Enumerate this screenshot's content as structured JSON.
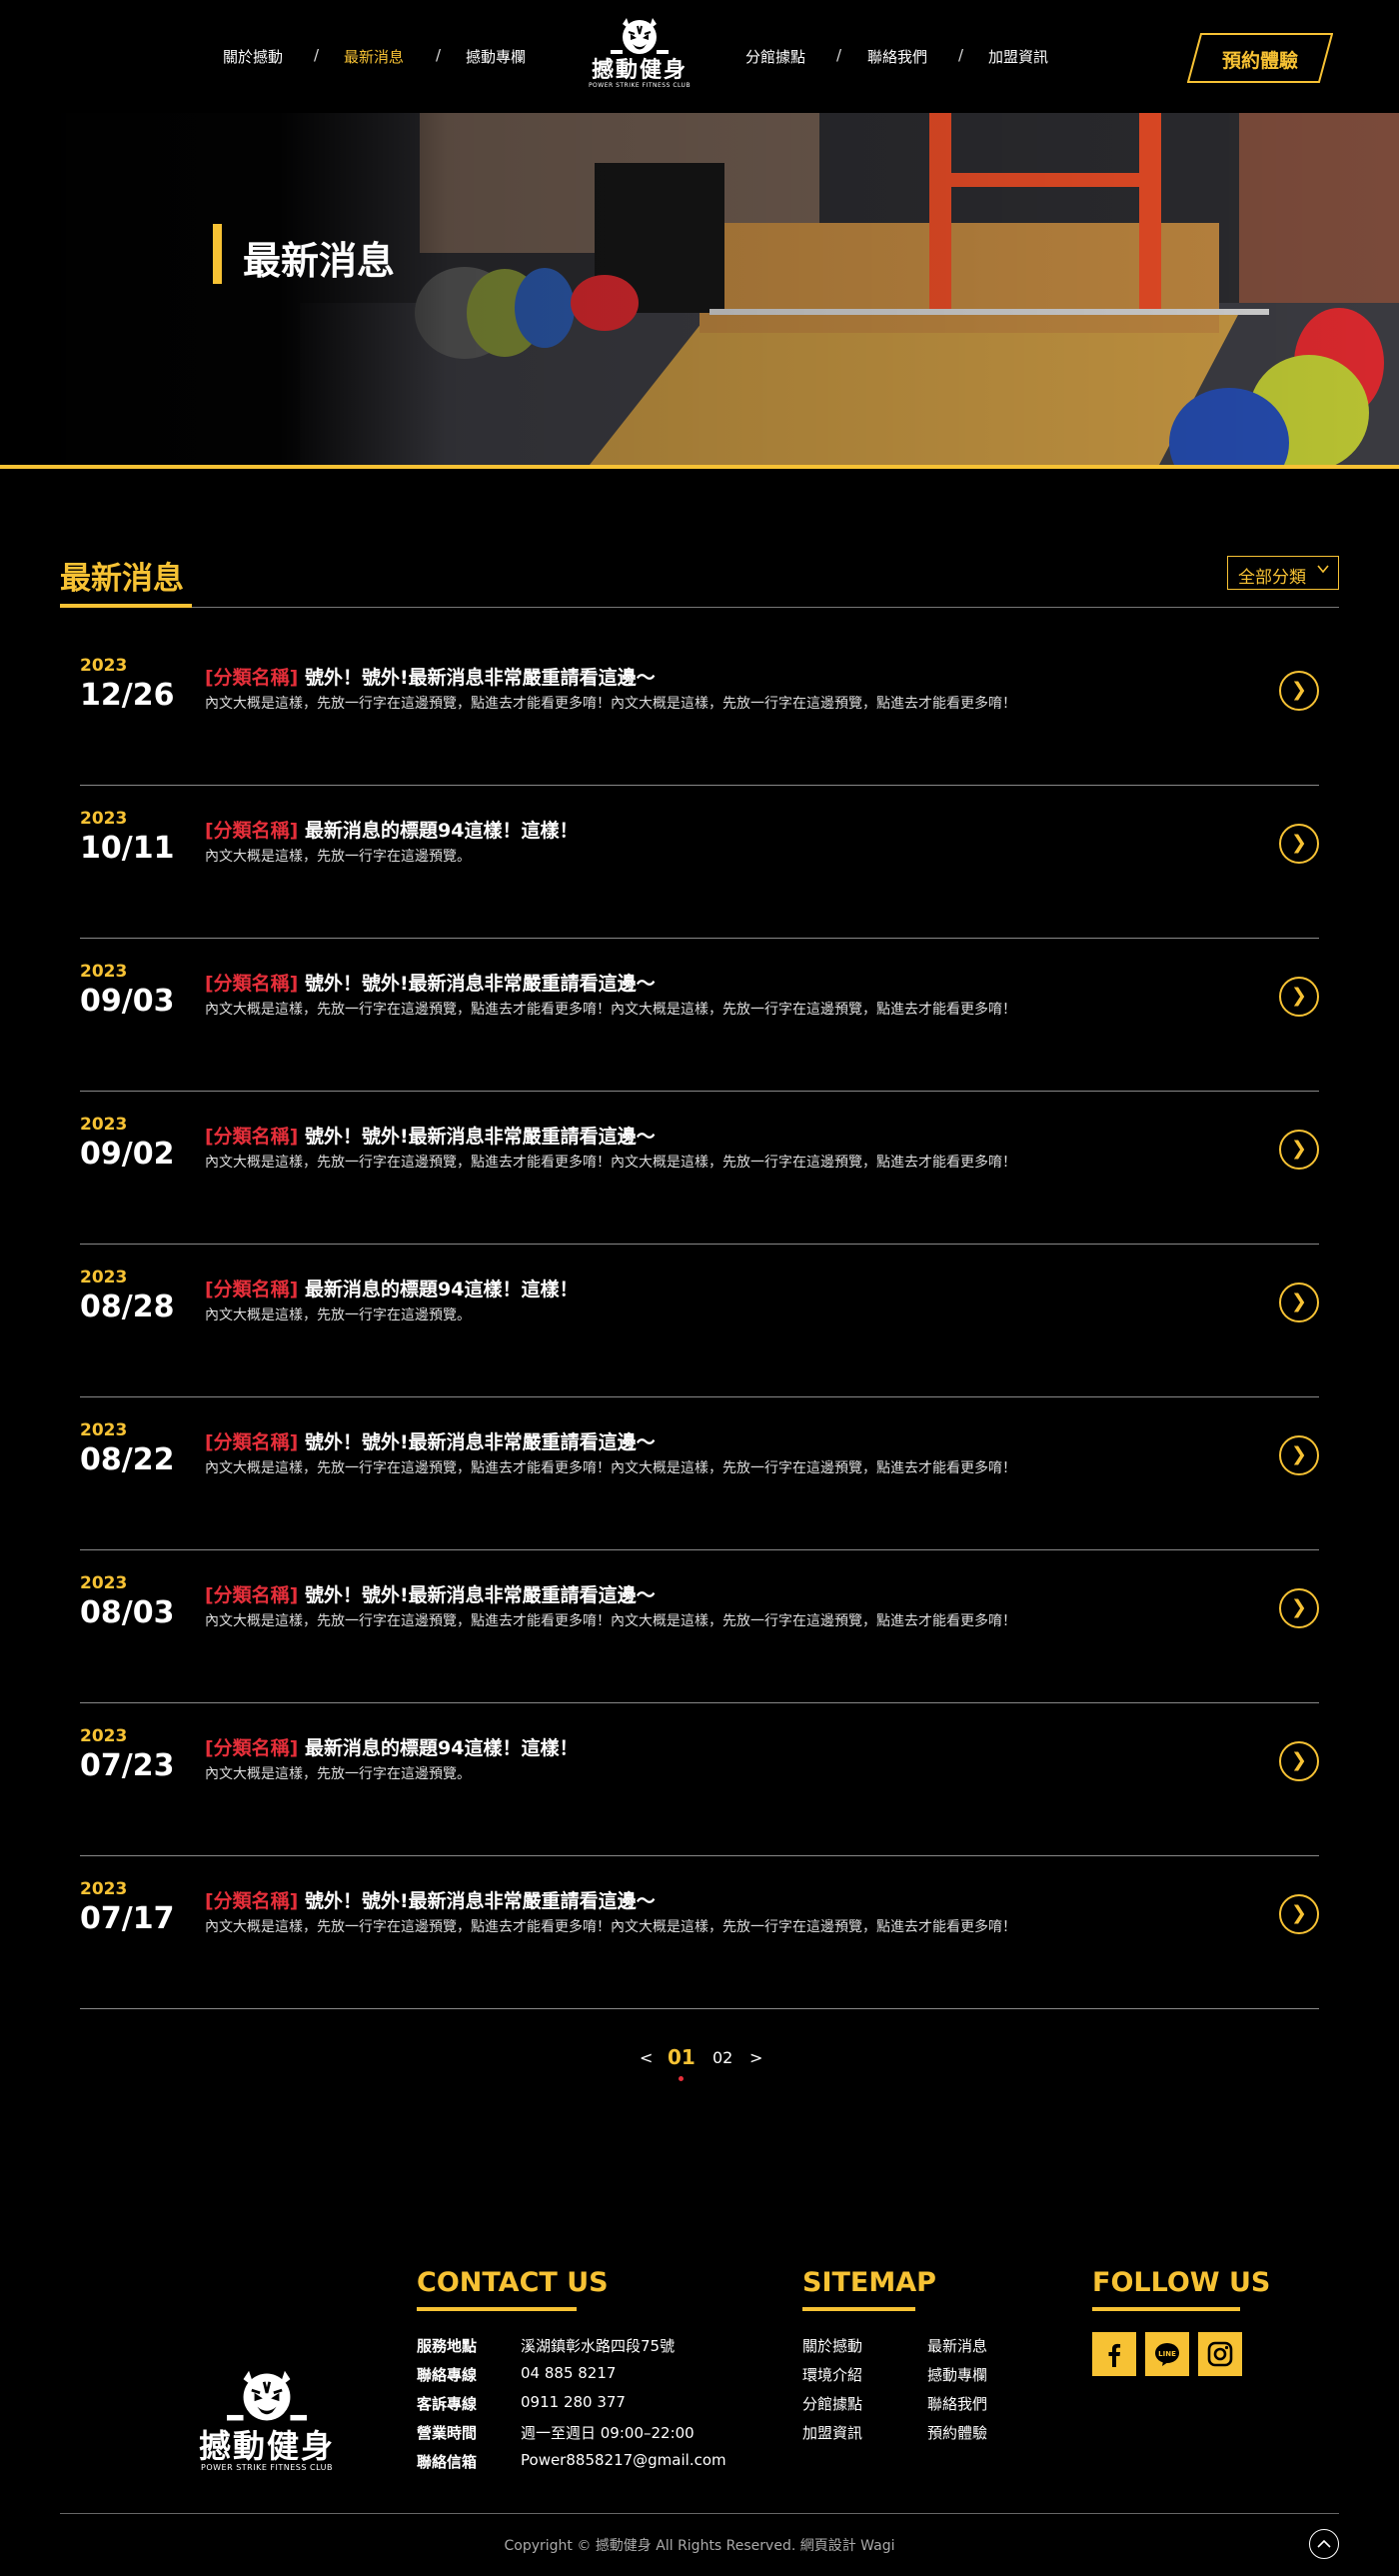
{
  "header": {
    "nav_left": [
      "關於撼動",
      "最新消息",
      "撼動專欄"
    ],
    "nav_right": [
      "分館據點",
      "聯絡我們",
      "加盟資訊"
    ],
    "separator": "/",
    "logo_text": "撼動健身",
    "logo_sub": "POWER STRIKE FITNESS CLUB",
    "book_button": "預約體驗",
    "active_nav": "最新消息"
  },
  "hero": {
    "title": "最新消息"
  },
  "news": {
    "heading": "最新消息",
    "category_select": "全部分類",
    "items": [
      {
        "year": "2023",
        "date": "12/26",
        "category": "[分類名稱]",
        "title": "號外！號外!最新消息非常嚴重請看這邊～",
        "desc": "內文大概是這樣，先放一行字在這邊預覽，點進去才能看更多唷！內文大概是這樣，先放一行字在這邊預覽，點進去才能看更多唷！"
      },
      {
        "year": "2023",
        "date": "10/11",
        "category": "[分類名稱]",
        "title": "最新消息的標題94這樣！這樣！",
        "desc": "內文大概是這樣，先放一行字在這邊預覽。"
      },
      {
        "year": "2023",
        "date": "09/03",
        "category": "[分類名稱]",
        "title": "號外！號外!最新消息非常嚴重請看這邊～",
        "desc": "內文大概是這樣，先放一行字在這邊預覽，點進去才能看更多唷！內文大概是這樣，先放一行字在這邊預覽，點進去才能看更多唷！"
      },
      {
        "year": "2023",
        "date": "09/02",
        "category": "[分類名稱]",
        "title": "號外！號外!最新消息非常嚴重請看這邊～",
        "desc": "內文大概是這樣，先放一行字在這邊預覽，點進去才能看更多唷！內文大概是這樣，先放一行字在這邊預覽，點進去才能看更多唷！"
      },
      {
        "year": "2023",
        "date": "08/28",
        "category": "[分類名稱]",
        "title": "最新消息的標題94這樣！這樣！",
        "desc": "內文大概是這樣，先放一行字在這邊預覽。"
      },
      {
        "year": "2023",
        "date": "08/22",
        "category": "[分類名稱]",
        "title": "號外！號外!最新消息非常嚴重請看這邊～",
        "desc": "內文大概是這樣，先放一行字在這邊預覽，點進去才能看更多唷！內文大概是這樣，先放一行字在這邊預覽，點進去才能看更多唷！"
      },
      {
        "year": "2023",
        "date": "08/03",
        "category": "[分類名稱]",
        "title": "號外！號外!最新消息非常嚴重請看這邊～",
        "desc": "內文大概是這樣，先放一行字在這邊預覽，點進去才能看更多唷！內文大概是這樣，先放一行字在這邊預覽，點進去才能看更多唷！"
      },
      {
        "year": "2023",
        "date": "07/23",
        "category": "[分類名稱]",
        "title": "最新消息的標題94這樣！這樣！",
        "desc": "內文大概是這樣，先放一行字在這邊預覽。"
      },
      {
        "year": "2023",
        "date": "07/17",
        "category": "[分類名稱]",
        "title": "號外！號外!最新消息非常嚴重請看這邊～",
        "desc": "內文大概是這樣，先放一行字在這邊預覽，點進去才能看更多唷！內文大概是這樣，先放一行字在這邊預覽，點進去才能看更多唷！"
      }
    ]
  },
  "pagination": {
    "prev": "<",
    "next": ">",
    "pages": [
      "01",
      "02"
    ],
    "current": "01"
  },
  "footer": {
    "logo_text": "撼動健身",
    "logo_sub": "POWER STRIKE FITNESS CLUB",
    "contact_heading": "CONTACT US",
    "contact": [
      {
        "label": "服務地點",
        "value": "溪湖鎮彰水路四段75號"
      },
      {
        "label": "聯絡專線",
        "value": "04 885 8217"
      },
      {
        "label": "客訴專線",
        "value": "0911 280 377"
      },
      {
        "label": "營業時間",
        "value": "週一至週日 09:00–22:00"
      },
      {
        "label": "聯絡信箱",
        "value": "Power8858217@gmail.com"
      }
    ],
    "sitemap_heading": "SITEMAP",
    "sitemap_col1": [
      "關於撼動",
      "環境介紹",
      "分館據點",
      "加盟資訊"
    ],
    "sitemap_col2": [
      "最新消息",
      "撼動專欄",
      "聯絡我們",
      "預約體驗"
    ],
    "follow_heading": "FOLLOW US",
    "social_icons": [
      "facebook-icon",
      "line-icon",
      "instagram-icon"
    ],
    "line_label": "LINE",
    "copyright": "Copyright © 撼動健身 All Rights Reserved. 網頁設計 Wagi"
  },
  "colors": {
    "accent": "#f7c234",
    "category": "#e62f3a",
    "background": "#000000"
  }
}
